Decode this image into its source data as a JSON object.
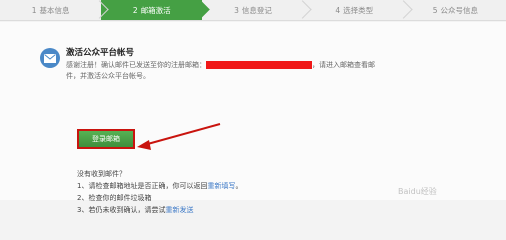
{
  "steps": [
    {
      "num": "1",
      "label": "基本信息"
    },
    {
      "num": "2",
      "label": "邮箱激活"
    },
    {
      "num": "3",
      "label": "信息登记"
    },
    {
      "num": "4",
      "label": "选择类型"
    },
    {
      "num": "5",
      "label": "公众号信息"
    }
  ],
  "active_step": 2,
  "panel": {
    "title": "激活公众平台帐号",
    "desc_before": "感谢注册！确认邮件已发送至你的注册邮箱：",
    "desc_after": "，请进入邮箱查看邮件，并激活公众平台帐号。",
    "login_button": "登录邮箱"
  },
  "help": {
    "question": "没有收到邮件？",
    "item1_prefix": "1、请检查邮箱地址是否正确，你可以返回",
    "item1_link": "重新填写",
    "item1_suffix": "。",
    "item2": "2、检查你的邮件垃圾箱",
    "item3_prefix": "3、若仍未收到确认，请尝试",
    "item3_link": "重新发送"
  },
  "watermark": "Baidu经验",
  "colors": {
    "active_step": "#45a044",
    "button": "#45a044",
    "annotation": "#c9140e",
    "redaction": "#f01818",
    "link": "#3e7ac7"
  },
  "icons": {
    "mail": "mail-icon"
  }
}
